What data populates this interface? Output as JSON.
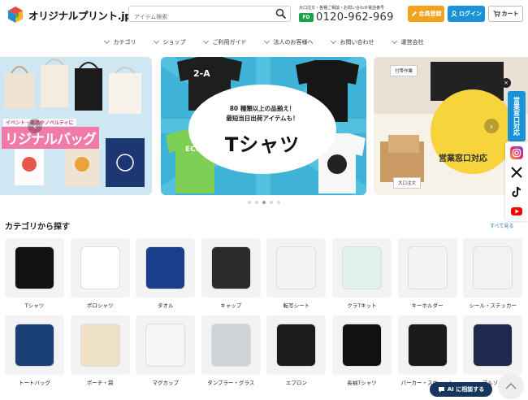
{
  "header": {
    "logo_text": "オリジナルプリント.jp",
    "search_placeholder": "アイテム検索",
    "phone_note": "大口注文・各種ご相談・お問い合わせ電話番号",
    "freedial_badge": "FD",
    "phone_number": "0120-962-969",
    "register_label": "会員登録",
    "login_label": "ログイン",
    "cart_label": "カート"
  },
  "nav": {
    "items": [
      "カテゴリ",
      "ショップ",
      "ご利用ガイド",
      "法人のお客様へ",
      "お問い合わせ",
      "運営会社"
    ]
  },
  "hero": {
    "bag_sub": "イベント・商品やノベルティに",
    "bag_label": "リジナルバッグ",
    "tee_line1": "80 種類以上の品揃え！",
    "tee_line2": "最短当日出荷アイテムも！",
    "tee_title": "Tシャツ",
    "office_tag": "付帯作業",
    "office_text": "営業窓口対応",
    "office_tag2": "大口注文",
    "slide_count": 5,
    "active_slide": 2
  },
  "rail": {
    "close": "×",
    "sales_label": "営業窓口対応",
    "sns": [
      "instagram-icon",
      "x-icon",
      "tiktok-icon",
      "youtube-icon"
    ]
  },
  "categories": {
    "title": "カテゴリから探す",
    "see_all": "すべて見る",
    "items": [
      {
        "label": "Tシャツ",
        "color": "#111111"
      },
      {
        "label": "ポロシャツ",
        "color": "#ffffff"
      },
      {
        "label": "タオル",
        "color": "#1a3e8c"
      },
      {
        "label": "キャップ",
        "color": "#2b2b2b"
      },
      {
        "label": "転写シート",
        "color": "#f4f4f4"
      },
      {
        "label": "クラTキット",
        "color": "#dff2ee"
      },
      {
        "label": "キーホルダー",
        "color": "#f3f3f3"
      },
      {
        "label": "シール・ステッカー",
        "color": "#f2f2f2"
      },
      {
        "label": "トートバッグ",
        "color": "#1b3f77"
      },
      {
        "label": "ポーチ・袋",
        "color": "#efe1c6"
      },
      {
        "label": "マグカップ",
        "color": "#f6f6f6"
      },
      {
        "label": "タンブラー・グラス",
        "color": "#cfd3d6"
      },
      {
        "label": "エプロン",
        "color": "#1b1b1b"
      },
      {
        "label": "長袖Tシャツ",
        "color": "#111111"
      },
      {
        "label": "パーカー・スウェット",
        "color": "#1a1a1a"
      },
      {
        "label": "ブルゾン",
        "color": "#1d2a4d"
      }
    ]
  },
  "ai_button": "AI に相談する"
}
